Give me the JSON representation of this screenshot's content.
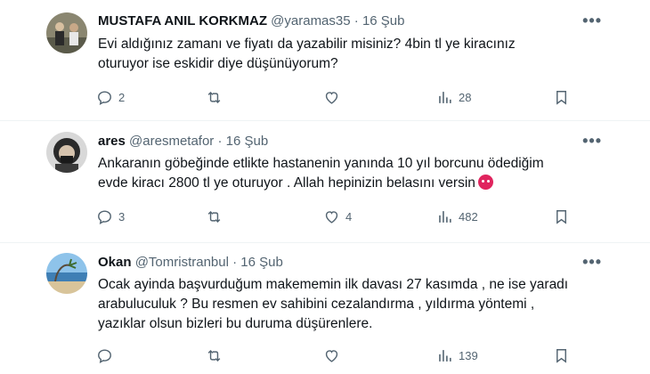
{
  "tweets": [
    {
      "name": "MUSTAFA ANIL KORKMAZ",
      "handle": "@yaramas35",
      "separator": "·",
      "date": "16 Şub",
      "more": "•••",
      "text_lines": [
        "Evi aldığınız zamanı ve fiyatı da yazabilir misiniz? 4bin tl ye  kiracınız",
        "oturuyor ise eskidir diye düşünüyorum?"
      ],
      "replies": "2",
      "retweets": "",
      "likes": "",
      "views": "28",
      "avatar_color": "#6b6b5a"
    },
    {
      "name": "ares",
      "handle": "@aresmetafor",
      "separator": "·",
      "date": "16 Şub",
      "more": "•••",
      "text_lines": [
        "Ankaranın göbeğinde etlikte hastanenin yanında 10 yıl borcunu ödediğim",
        "evde kiracı 2800 tl ye oturuyor . Allah hepinizin belasını versin"
      ],
      "emoji": "angry-face-emoji",
      "replies": "3",
      "retweets": "",
      "likes": "4",
      "views": "482",
      "avatar_color": "#3a3a3a"
    },
    {
      "name": "Okan",
      "handle": "@Tomristranbul",
      "separator": "·",
      "date": "16 Şub",
      "more": "•••",
      "text_lines": [
        "Ocak ayinda başvurduğum makememin ilk davası 27 kasımda , ne ise yaradı",
        "arabuluculuk ? Bu resmen ev sahibini cezalandırma , yıldırma yöntemi ,",
        "yazıklar olsun bizleri bu duruma düşürenlere."
      ],
      "replies": "",
      "retweets": "",
      "likes": "",
      "views": "139",
      "avatar_color": "#4a90c8"
    }
  ],
  "colors": {
    "text": "#0f1419",
    "muted": "#536471",
    "divider": "#eff3f4"
  }
}
